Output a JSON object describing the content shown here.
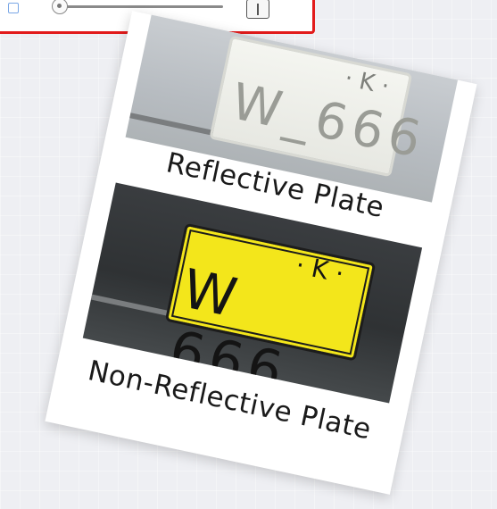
{
  "ui_panel": {
    "step_button_symbol": "|"
  },
  "photos": [
    {
      "caption": "Reflective Plate",
      "plate_text": "W_666",
      "plate_mark": "· K ·",
      "plate_color": "#f4f5f0"
    },
    {
      "caption": "Non-Reflective Plate",
      "plate_text": "W 666",
      "plate_mark": "· K ·",
      "plate_color": "#f3e61b"
    }
  ],
  "colors": {
    "panel_border": "#e21b1b",
    "page_background": "#eeeff3"
  }
}
